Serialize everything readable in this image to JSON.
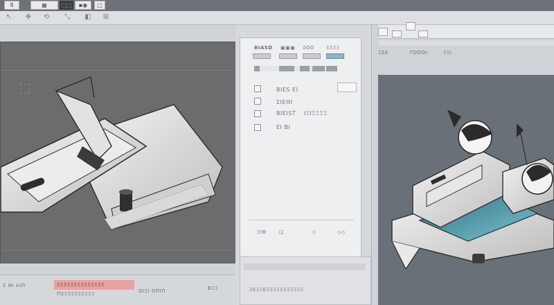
{
  "topbar": {
    "tabs": [
      {
        "label": "8"
      },
      {
        "label": "▦"
      },
      {
        "label": "⬚⬚"
      },
      {
        "label": "▪◉"
      },
      {
        "label": "□"
      }
    ]
  },
  "toolbar": {
    "icons": [
      "cursor-icon",
      "move-icon",
      "rotate-icon",
      "scale-icon",
      "view-icon"
    ]
  },
  "panel": {
    "header_labels": [
      "BIASD",
      "▣▣▣",
      "ΞΟΟ",
      "ΞΞΞΞ"
    ],
    "rows": [
      {
        "label": "BIES EI"
      },
      {
        "label": "ΣΙΕΘΙ"
      },
      {
        "label": "BIEIST"
      },
      {
        "label": "EI BI"
      }
    ],
    "side_label": "ΙΞΙΞΞΞΞ",
    "footer_labels": [
      "ΞΙΘ",
      "◫",
      "◇",
      "◇◇"
    ]
  },
  "right_panel": {
    "tab_labels": [
      "ΞΣΕ",
      "ΓΟΟΟΙ",
      "ΞΞΙ"
    ]
  },
  "bottom": {
    "left_labels": [
      "Σ ΘΙ ΑΙΠ",
      "ΠΣΞΞΞΞΞΞΞΞΞ",
      "ΟΙΞΙ ΟΠΙΠ",
      "ΒΞΞ"
    ],
    "highlight_label": "ΞΞΞΞΞΞΞΞΞΞΞΞΞΞ",
    "center_labels": [
      "ΞΕΞΞΕΞΞΞΞΞΞΞΞΞΞΞ"
    ]
  },
  "colors": {
    "accent_red": "#e7a3a1",
    "viewport_left": "#6b6c6e",
    "viewport_right": "#6a7078",
    "teal_surface": "#3f8fa3"
  }
}
